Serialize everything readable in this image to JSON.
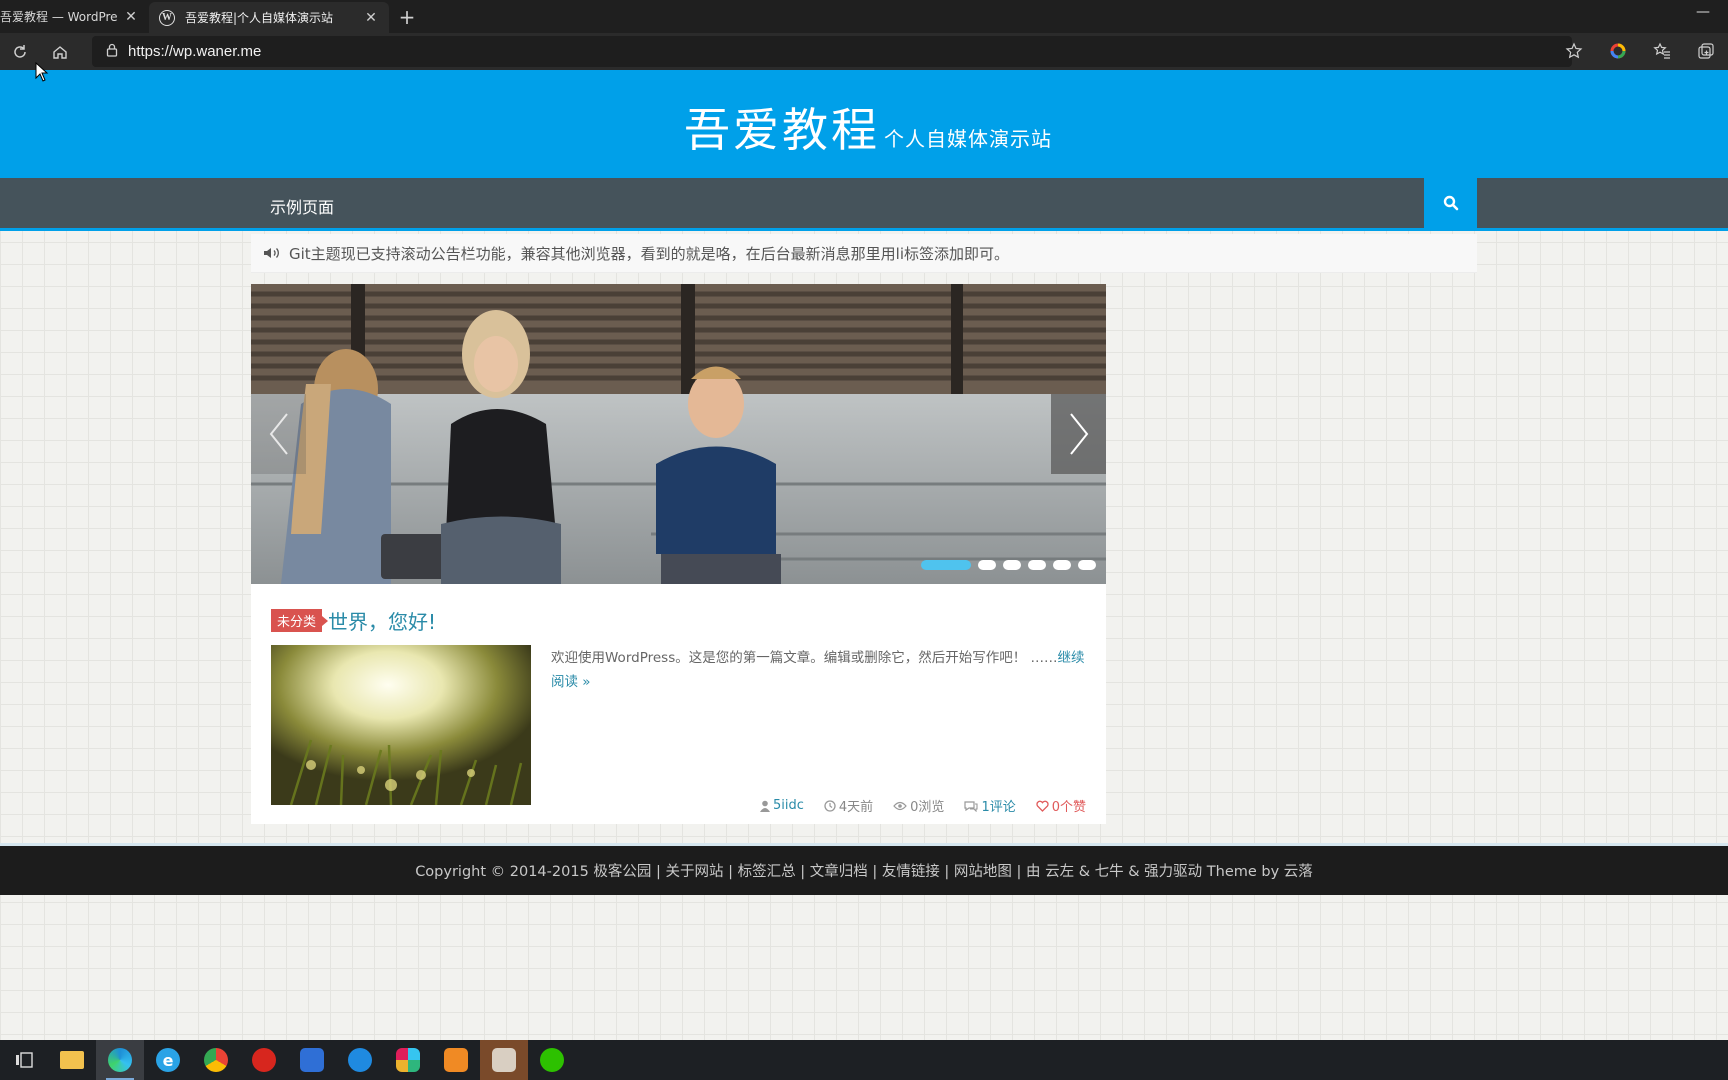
{
  "browser": {
    "tabs": [
      {
        "title": "吾爱教程 — WordPre",
        "active": false
      },
      {
        "title": "吾爱教程|个人自媒体演示站",
        "active": true
      }
    ],
    "url": "https://wp.waner.me"
  },
  "site": {
    "logo_main": "吾爱教程",
    "logo_sub": "个人自媒体演示站",
    "nav": {
      "items": [
        "示例页面"
      ]
    },
    "notice": "Git主题现已支持滚动公告栏功能，兼容其他浏览器，看到的就是咯，在后台最新消息那里用li标签添加即可。",
    "slider": {
      "slide_count": 6,
      "active_index": 0
    },
    "post": {
      "category": "未分类",
      "title": "世界，您好!",
      "excerpt": "欢迎使用WordPress。这是您的第一篇文章。编辑或删除它，然后开始写作吧！ ……",
      "read_more": "继续阅读 »",
      "meta": {
        "author": "5iidc",
        "time": "4天前",
        "views": "0浏览",
        "comments": "1评论",
        "likes": "0个赞"
      }
    },
    "footer": "Copyright © 2014-2015 极客公园 | 关于网站 | 标签汇总 | 文章归档 | 友情链接 | 网站地图 | 由 云左 & 七牛 & 强力驱动 Theme by 云落"
  },
  "colors": {
    "header_bg": "#00a0e9",
    "nav_bg": "#45535b",
    "link": "#2a8ba8",
    "category_badge": "#d9534f"
  },
  "taskbar": {
    "icons": [
      "task-view-icon",
      "file-explorer-icon",
      "edge-icon",
      "ie-icon",
      "chrome-icon",
      "app-red-icon",
      "app-blue-icon",
      "app-feather-icon",
      "slack-icon",
      "app-orange-icon",
      "app-image-icon",
      "wechat-icon"
    ]
  }
}
